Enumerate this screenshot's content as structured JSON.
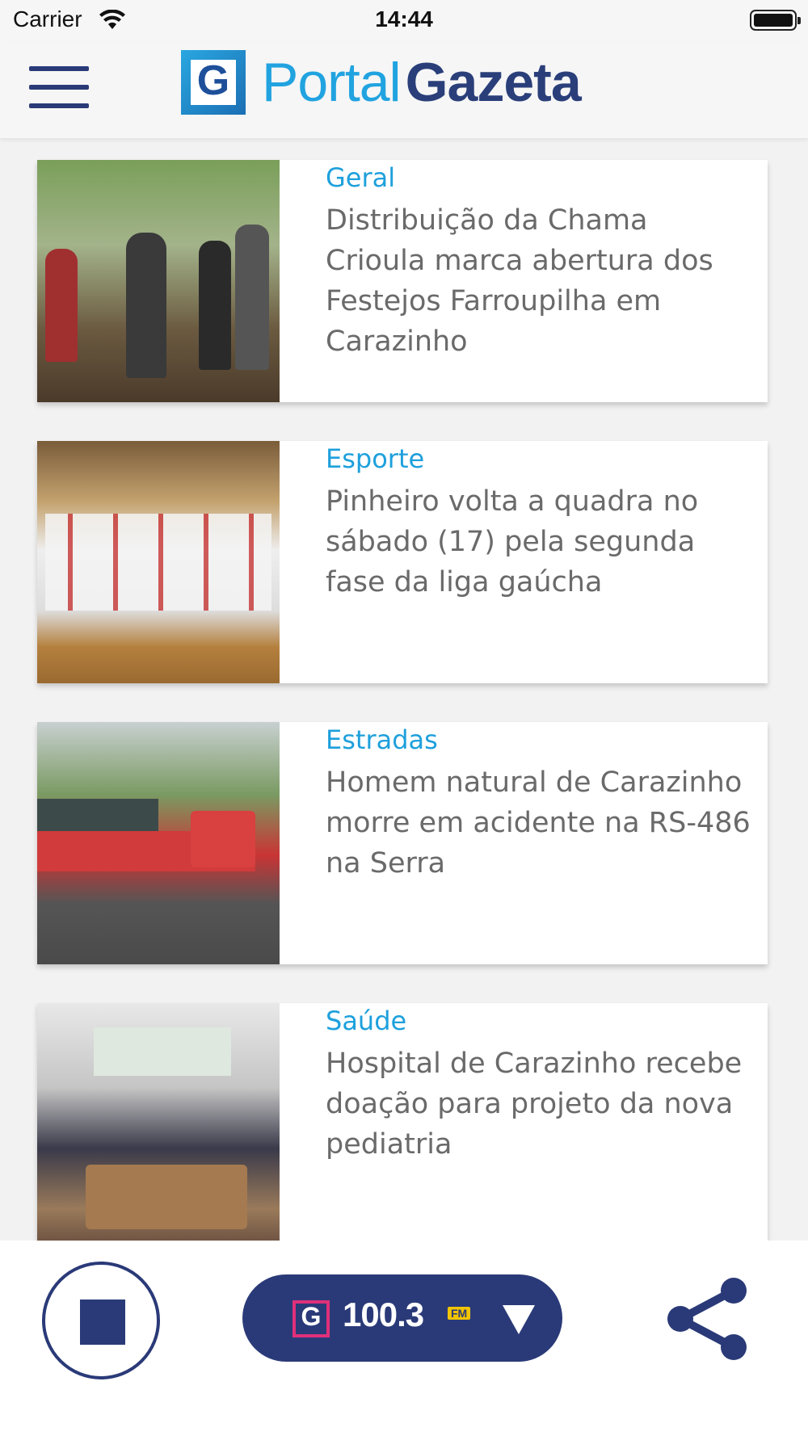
{
  "status_bar": {
    "carrier": "Carrier",
    "time": "14:44"
  },
  "header": {
    "logo_part1": "Portal",
    "logo_part2": "Gazeta"
  },
  "articles": [
    {
      "category": "Geral",
      "title": "Distribuição da Chama Crioula marca abertura dos Festejos Farroupilha em Carazinho"
    },
    {
      "category": "Esporte",
      "title": "Pinheiro volta a quadra no sábado (17) pela segunda fase da liga gaúcha"
    },
    {
      "category": "Estradas",
      "title": "Homem natural de Carazinho morre em acidente na RS-486 na Serra"
    },
    {
      "category": "Saúde",
      "title": "Hospital de Carazinho recebe doação para projeto da nova pediatria"
    }
  ],
  "player": {
    "frequency": "100.3",
    "band": "FM"
  },
  "colors": {
    "brand_navy": "#2a3a78",
    "brand_blue": "#21a3e0",
    "category": "#1ea0dc",
    "title_text": "#6a6a6a",
    "station_logo_accent": "#e0307a",
    "fm_badge": "#f2c400"
  },
  "icons": {
    "menu": "hamburger-menu-icon",
    "stop": "stop-icon",
    "dropdown": "chevron-down-icon",
    "share": "share-icon",
    "wifi": "wifi-icon",
    "battery": "battery-icon"
  }
}
